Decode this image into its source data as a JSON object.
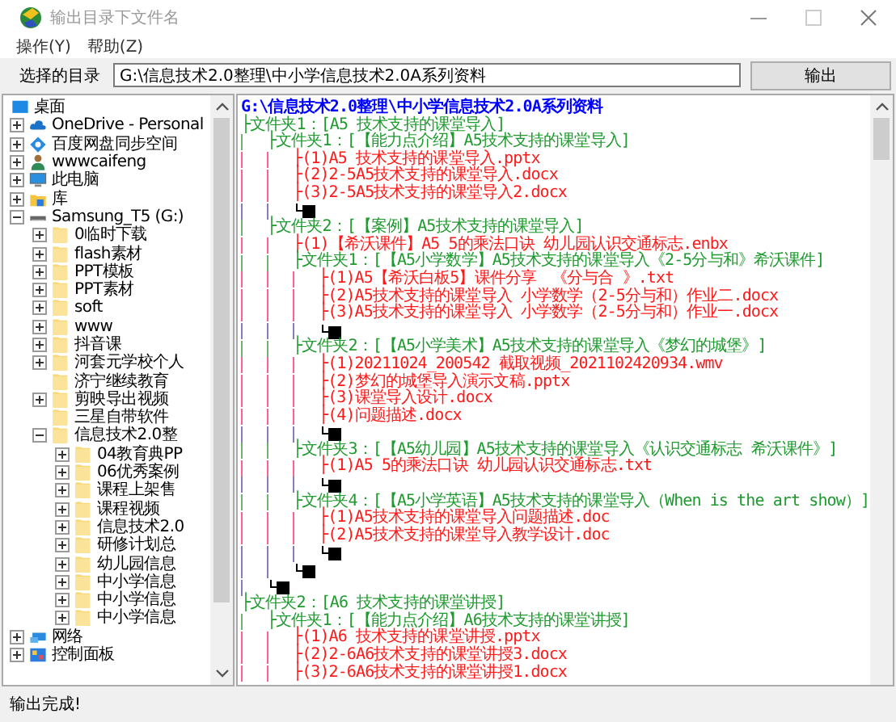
{
  "window": {
    "title": "输出目录下文件名"
  },
  "menu": [
    "操作(Y)",
    "帮助(Z)"
  ],
  "directory": {
    "label": "选择的目录",
    "value": "G:\\信息技术2.0整理\\中小学信息技术2.0A系列资料",
    "button": "输出"
  },
  "tree": [
    {
      "label": "桌面",
      "kind": "desktop",
      "children": [
        {
          "label": "OneDrive - Personal",
          "kind": "cloud",
          "expanded": false
        },
        {
          "label": "百度网盘同步空间",
          "kind": "sync",
          "expanded": false
        },
        {
          "label": "wwwcaifeng",
          "kind": "user",
          "expanded": false
        },
        {
          "label": "此电脑",
          "kind": "computer",
          "expanded": false
        },
        {
          "label": "库",
          "kind": "library",
          "expanded": false
        },
        {
          "label": "Samsung_T5 (G:)",
          "kind": "drive",
          "expanded": true,
          "children": [
            {
              "label": "0临时下载",
              "kind": "folder",
              "expanded": false
            },
            {
              "label": "flash素材",
              "kind": "folder",
              "expanded": false
            },
            {
              "label": "PPT模板",
              "kind": "folder",
              "expanded": false
            },
            {
              "label": "PPT素材",
              "kind": "folder",
              "expanded": false
            },
            {
              "label": "soft",
              "kind": "folder",
              "expanded": false
            },
            {
              "label": "www",
              "kind": "folder",
              "expanded": false
            },
            {
              "label": "抖音课",
              "kind": "folder",
              "expanded": false
            },
            {
              "label": "河套元学校个人",
              "kind": "folder",
              "expanded": false
            },
            {
              "label": "济宁继续教育",
              "kind": "folder"
            },
            {
              "label": "剪映导出视频",
              "kind": "folder",
              "expanded": false
            },
            {
              "label": "三星自带软件",
              "kind": "folder"
            },
            {
              "label": "信息技术2.0整",
              "kind": "folder",
              "expanded": true,
              "children": [
                {
                  "label": "04教育典PP",
                  "kind": "folder",
                  "expanded": false
                },
                {
                  "label": "06优秀案例",
                  "kind": "folder",
                  "expanded": false
                },
                {
                  "label": "课程上架售",
                  "kind": "folder",
                  "expanded": false
                },
                {
                  "label": "课程视频",
                  "kind": "folder",
                  "expanded": false
                },
                {
                  "label": "信息技术2.0",
                  "kind": "folder",
                  "expanded": false
                },
                {
                  "label": "研修计划总",
                  "kind": "folder",
                  "expanded": false
                },
                {
                  "label": "幼儿园信息",
                  "kind": "folder",
                  "expanded": false
                },
                {
                  "label": "中小学信息",
                  "kind": "folder",
                  "expanded": false
                },
                {
                  "label": "中小学信息",
                  "kind": "folder",
                  "expanded": false
                },
                {
                  "label": "中小学信息",
                  "kind": "folder",
                  "expanded": false
                }
              ]
            }
          ]
        },
        {
          "label": "网络",
          "kind": "network",
          "expanded": false
        },
        {
          "label": "控制面板",
          "kind": "control-panel",
          "expanded": false
        }
      ]
    }
  ],
  "output": {
    "header": "G:\\信息技术2.0整理\\中小学信息技术2.0A系列资料",
    "items": [
      {
        "kind": "folder",
        "label": "├文件夹1：[A5 技术支持的课堂导入]",
        "closed": true,
        "children": [
          {
            "kind": "folder",
            "label": "├文件夹1：[【能力点介绍】A5技术支持的课堂导入]",
            "closed": true,
            "children": [
              {
                "kind": "file",
                "label": "├(1)A5 技术支持的课堂导入.pptx"
              },
              {
                "kind": "file",
                "label": "├(2)2-5A5技术支持的课堂导入.docx"
              },
              {
                "kind": "file",
                "label": "├(3)2-5A5技术支持的课堂导入2.docx"
              }
            ]
          },
          {
            "kind": "folder",
            "label": "├文件夹2：[【案例】A5技术支持的课堂导入]",
            "closed": true,
            "children": [
              {
                "kind": "file",
                "label": "├(1)【希沃课件】A5 5的乘法口诀 幼儿园认识交通标志.enbx"
              },
              {
                "kind": "folder",
                "label": "├文件夹1：[【A5小学数学】A5技术支持的课堂导入《2-5分与和》希沃课件]",
                "closed": true,
                "children": [
                  {
                    "kind": "file",
                    "label": "├(1)A5【希沃白板5】课件分享　《分与合 》.txt"
                  },
                  {
                    "kind": "file",
                    "label": "├(2)A5技术支持的课堂导入 小学数学（2-5分与和）作业二.docx"
                  },
                  {
                    "kind": "file",
                    "label": "├(3)A5技术支持的课堂导入 小学数学（2-5分与和）作业一.docx"
                  }
                ]
              },
              {
                "kind": "folder",
                "label": "├文件夹2：[【A5小学美术】A5技术支持的课堂导入《梦幻的城堡》]",
                "closed": true,
                "children": [
                  {
                    "kind": "file",
                    "label": "├(1)20211024_200542 截取视频_2021102420934.wmv"
                  },
                  {
                    "kind": "file",
                    "label": "├(2)梦幻的城堡导入演示文稿.pptx"
                  },
                  {
                    "kind": "file",
                    "label": "├(3)课堂导入设计.docx"
                  },
                  {
                    "kind": "file",
                    "label": "├(4)问题描述.docx"
                  }
                ]
              },
              {
                "kind": "folder",
                "label": "├文件夹3：[【A5幼儿园】A5技术支持的课堂导入《认识交通标志 希沃课件》]",
                "closed": true,
                "children": [
                  {
                    "kind": "file",
                    "label": "├(1)A5 5的乘法口诀 幼儿园认识交通标志.txt"
                  }
                ]
              },
              {
                "kind": "folder",
                "label": "├文件夹4：[【A5小学英语】A5技术支持的课堂导入（When is the art show）]",
                "closed": true,
                "children": [
                  {
                    "kind": "file",
                    "label": "├(1)A5技术支持的课堂导入问题描述.doc"
                  },
                  {
                    "kind": "file",
                    "label": "├(2)A5技术支持的课堂导入教学设计.doc"
                  }
                ]
              }
            ]
          }
        ]
      },
      {
        "kind": "folder",
        "label": "├文件夹2：[A6 技术支持的课堂讲授]",
        "closed": false,
        "children": [
          {
            "kind": "folder",
            "label": "├文件夹1：[【能力点介绍】A6技术支持的课堂讲授]",
            "closed": false,
            "children": [
              {
                "kind": "file",
                "label": "├(1)A6 技术支持的课堂讲授.pptx"
              },
              {
                "kind": "file",
                "label": "├(2)2-6A6技术支持的课堂讲授3.docx"
              },
              {
                "kind": "file",
                "label": "├(3)2-6A6技术支持的课堂讲授1.docx"
              }
            ]
          }
        ]
      }
    ]
  },
  "status_bar": "输出完成!"
}
